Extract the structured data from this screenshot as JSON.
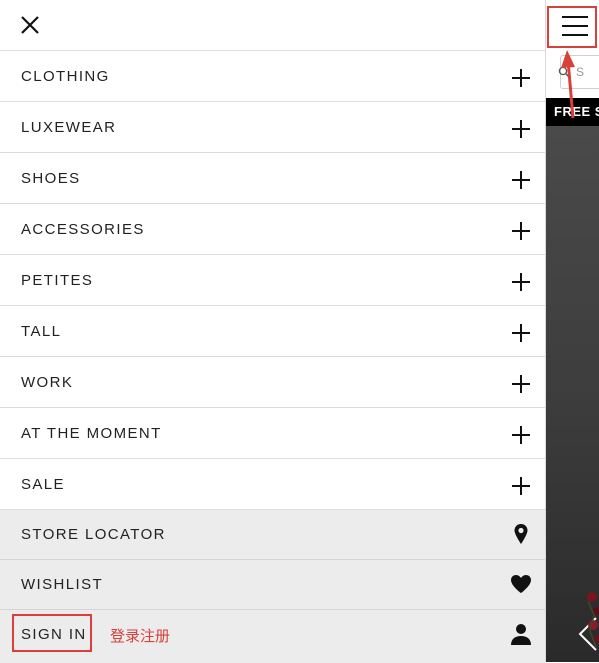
{
  "drawer": {
    "menu_items": [
      {
        "label": "CLOTHING"
      },
      {
        "label": "LUXEWEAR"
      },
      {
        "label": "SHOES"
      },
      {
        "label": "ACCESSORIES"
      },
      {
        "label": "PETITES"
      },
      {
        "label": "TALL"
      },
      {
        "label": "WORK"
      },
      {
        "label": "AT THE MOMENT"
      },
      {
        "label": "SALE"
      }
    ],
    "utility_items": [
      {
        "label": "STORE LOCATOR",
        "icon": "map-pin-icon"
      },
      {
        "label": "WISHLIST",
        "icon": "heart-icon"
      }
    ],
    "sign_in": {
      "label": "SIGN IN",
      "icon": "user-icon",
      "annotation": "登录注册"
    }
  },
  "right_page": {
    "promo_text": "FREE S",
    "search_placeholder": "S"
  },
  "colors": {
    "annotation_red": "#d9403a",
    "utility_bg": "#ececec",
    "promo_bg": "#000000"
  }
}
